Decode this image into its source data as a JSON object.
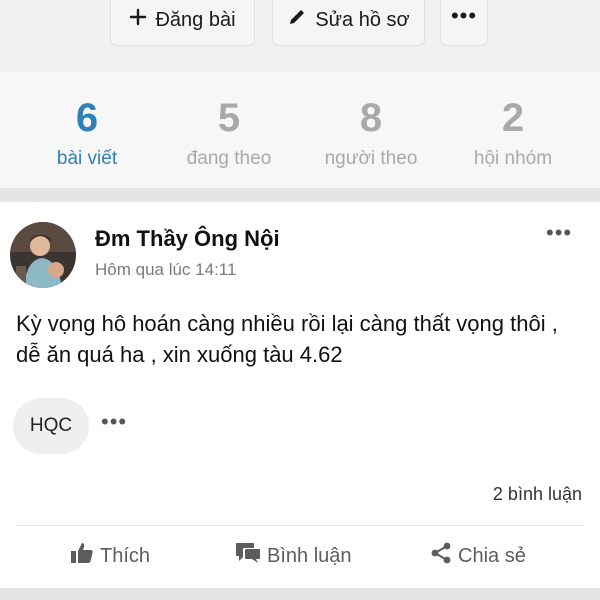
{
  "header": {
    "post_label": "Đăng bài",
    "edit_label": "Sửa hồ sơ",
    "more_label": "•••"
  },
  "stats": [
    {
      "value": "6",
      "label": "bài viết",
      "active": true
    },
    {
      "value": "5",
      "label": "đang theo",
      "active": false
    },
    {
      "value": "8",
      "label": "người theo",
      "active": false
    },
    {
      "value": "2",
      "label": "hội nhóm",
      "active": false
    }
  ],
  "post": {
    "author": "Đm Thầy Ông Nội",
    "time": "Hôm qua lúc 14:11",
    "more": "•••",
    "text": "Kỳ vọng hô hoán càng nhiều rồi lại càng thất vọng thôi , dễ ăn quá ha , xin xuống tàu 4.62",
    "tag": "HQC",
    "tag_more": "•••",
    "comments": "2 bình luận"
  },
  "actions": {
    "like": "Thích",
    "comment": "Bình luận",
    "share": "Chia sẻ"
  },
  "colors": {
    "accent": "#2f7fb8",
    "muted": "#a9a9a9"
  },
  "icons": [
    "plus-icon",
    "pencil-icon",
    "thumbs-up-icon",
    "comment-icon",
    "share-icon"
  ]
}
